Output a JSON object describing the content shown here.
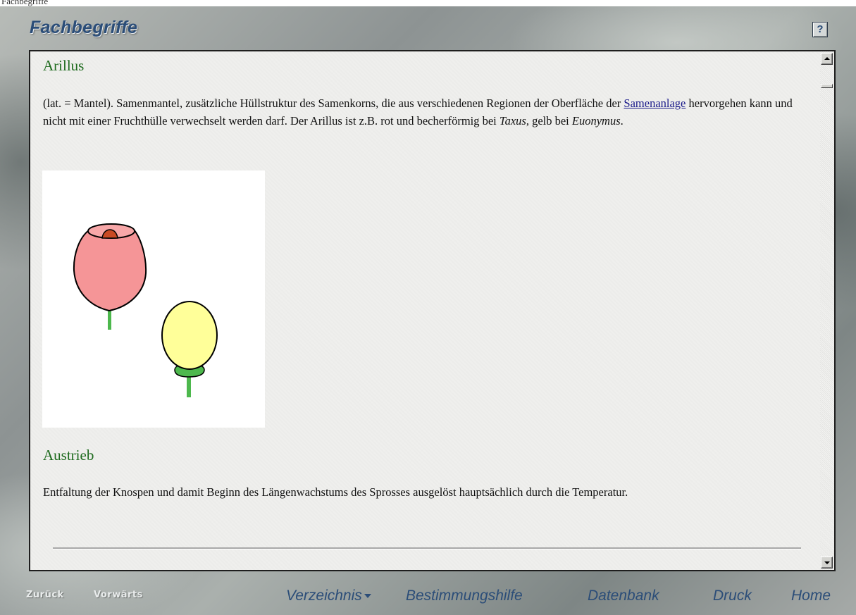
{
  "header": {
    "top_text": "Fachbegriffe",
    "title": "Fachbegriffe",
    "help_label": "?"
  },
  "entries": [
    {
      "term": "Arillus",
      "text_1": "(lat. = Mantel). Samenmantel, zusätzliche Hüllstruktur des Samenkorns, die aus verschiedenen Regionen der Oberfläche der ",
      "link": "Samenanlage",
      "text_2": " hervorgehen kann und nicht mit einer Fruchthülle verwechselt werden darf. Der Arillus ist z.B. rot und becherförmig bei ",
      "italic_1": "Taxus",
      "text_3": ", gelb bei ",
      "italic_2": "Euonymus",
      "text_4": "."
    },
    {
      "term": "Austrieb",
      "text": "Entfaltung der Knospen und damit Beginn des Längenwachstums des Sprosses ausgelöst hauptsächlich durch die Temperatur."
    }
  ],
  "illustration": {
    "red_arillus_fill": "#f59597",
    "seed_fill": "#c84a23",
    "yellow_arillus_fill": "#ffff99",
    "stem_color": "#4db84d"
  },
  "nav": {
    "back": "Zurück",
    "forward": "Vorwärts",
    "index": "Verzeichnis",
    "key": "Bestimmungshilfe",
    "database": "Datenbank",
    "print": "Druck",
    "home": "Home"
  },
  "colors": {
    "title": "#2b4d78",
    "heading": "#1e6b1e",
    "link": "#1a1a8a"
  }
}
